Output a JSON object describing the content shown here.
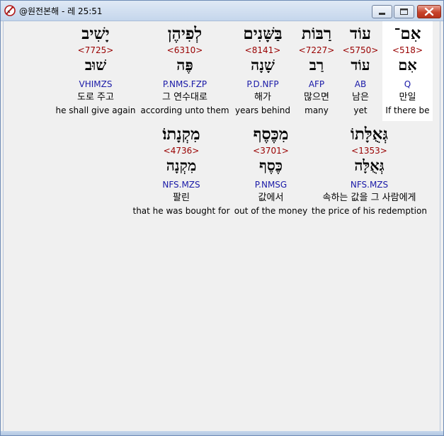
{
  "window": {
    "title": "@원전본해 - 레 25:51",
    "icons": {
      "app": "compass-feather-icon",
      "minimize": "minimize-icon",
      "maximize": "maximize-icon",
      "close": "close-icon"
    },
    "colors": {
      "strong_number": "#990000",
      "morphology": "#1a1aa8",
      "selected_bg": "#ffffff"
    }
  },
  "words": [
    {
      "hebrew": "אִם־",
      "strong": "<518>",
      "lemma": "אִם",
      "morph": "Q",
      "korean": "만일",
      "english": "If there be",
      "selected": true
    },
    {
      "hebrew": "עוֹד",
      "strong": "<5750>",
      "lemma": "עוֹד",
      "morph": "AB",
      "korean": "남은",
      "english": "yet",
      "selected": false
    },
    {
      "hebrew": "רַבּוֹת",
      "strong": "<7227>",
      "lemma": "רַב",
      "morph": "AFP",
      "korean": "많으면",
      "english": "many",
      "selected": false
    },
    {
      "hebrew": "בַּשָּׁנִים",
      "strong": "<8141>",
      "lemma": "שָׁנָה",
      "morph": "P.D.NFP",
      "korean": "해가",
      "english": "years behind",
      "selected": false
    },
    {
      "hebrew": "לְפִיהֶן",
      "strong": "<6310>",
      "lemma": "פֶּה",
      "morph": "P.NMS.FZP",
      "korean": "그 연수대로",
      "english": "according unto them",
      "selected": false
    },
    {
      "hebrew": "יָשִׁיב",
      "strong": "<7725>",
      "lemma": "שׁוּב",
      "morph": "VHIMZS",
      "korean": "도로 주고",
      "english": "he shall give again",
      "selected": false
    },
    {
      "hebrew": "גְּאֻלָּתוֹ",
      "strong": "<1353>",
      "lemma": "גְּאֻלָּה",
      "morph": "NFS.MZS",
      "korean": "속하는 값을 그 사람에게",
      "english": "the price of his redemption",
      "selected": false
    },
    {
      "hebrew": "מִכֶּסֶף",
      "strong": "<3701>",
      "lemma": "כֶּסֶף",
      "morph": "P.NMSG",
      "korean": "값에서",
      "english": "out of the money",
      "selected": false
    },
    {
      "hebrew": "מִקְנָתוֹ׃",
      "strong": "<4736>",
      "lemma": "מִקְנָה",
      "morph": "NFS.MZS",
      "korean": "팔린",
      "english": "that he was bought for",
      "selected": false
    }
  ]
}
